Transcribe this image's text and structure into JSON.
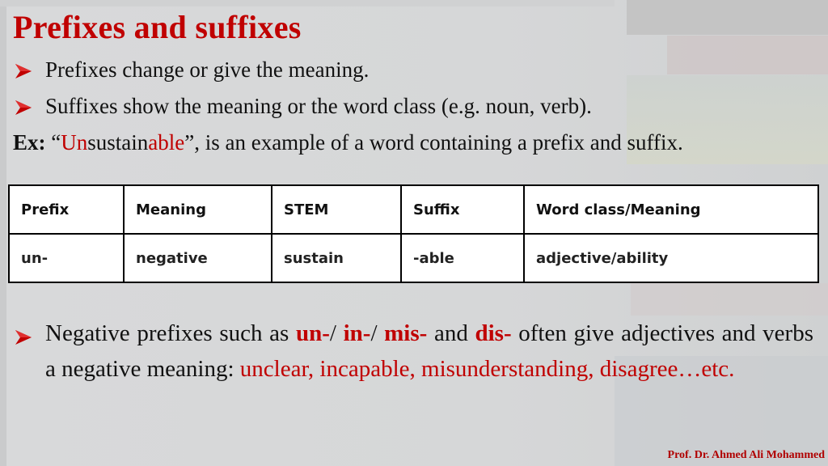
{
  "slide": {
    "title": "Prefixes and suffixes",
    "accent_color": "#c00000",
    "bullets": [
      {
        "icon": "arrow-bullet-icon",
        "text": "Prefixes change or give the meaning."
      },
      {
        "icon": "arrow-bullet-icon",
        "text": "Suffixes show the meaning or the word class (e.g. noun, verb)."
      }
    ],
    "example": {
      "label": "Ex:",
      "open_quote": "“",
      "word_prefix": "Un",
      "word_stem": "sustain",
      "word_suffix": "able",
      "close_rest": "”, is an example of a word containing a prefix and suffix."
    },
    "table": {
      "headers": [
        "Prefix",
        "Meaning",
        "STEM",
        "Suffix",
        "Word class/Meaning"
      ],
      "rows": [
        [
          "un-",
          "negative",
          "sustain",
          "-able",
          "adjective/ability"
        ]
      ]
    },
    "negative_note": {
      "icon": "arrow-bullet-icon",
      "intro": "Negative prefixes such as ",
      "p1": "un-",
      "sep1": "/ ",
      "p2": "in-",
      "sep2": "/ ",
      "p3": "mis-",
      "and": " and ",
      "p4": "dis-",
      "mid": " often give adjectives and verbs a negative meaning: ",
      "examples": "unclear, incapable, misunderstanding, disagree…etc."
    },
    "author": "Prof. Dr. Ahmed Ali Mohammed"
  }
}
